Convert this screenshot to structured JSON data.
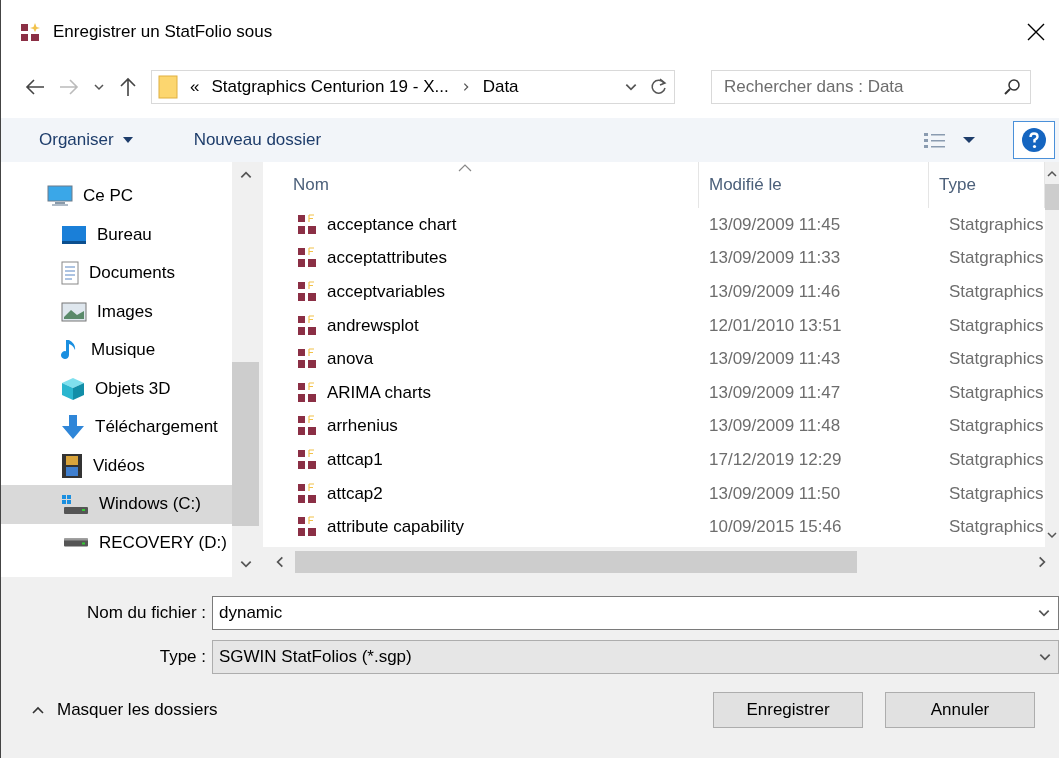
{
  "window": {
    "title": "Enregistrer un StatFolio sous"
  },
  "address_bar": {
    "overflow": "«",
    "segments": [
      "Statgraphics Centurion 19 - X...",
      "Data"
    ]
  },
  "search": {
    "placeholder": "Rechercher dans : Data"
  },
  "toolbar": {
    "organize": "Organiser",
    "new_folder": "Nouveau dossier"
  },
  "sidebar": {
    "items": [
      {
        "label": "Ce PC",
        "kind": "pc",
        "selected": false,
        "children": [
          {
            "label": "Bureau",
            "kind": "desktop",
            "selected": false
          },
          {
            "label": "Documents",
            "kind": "documents",
            "selected": false
          },
          {
            "label": "Images",
            "kind": "images",
            "selected": false
          },
          {
            "label": "Musique",
            "kind": "music",
            "selected": false
          },
          {
            "label": "Objets 3D",
            "kind": "objects3d",
            "selected": false
          },
          {
            "label": "Téléchargement",
            "kind": "downloads",
            "selected": false
          },
          {
            "label": "Vidéos",
            "kind": "videos",
            "selected": false
          },
          {
            "label": "Windows (C:)",
            "kind": "system_drive",
            "selected": true
          },
          {
            "label": "RECOVERY (D:)",
            "kind": "drive",
            "selected": false
          }
        ]
      }
    ]
  },
  "table": {
    "columns": [
      "Nom",
      "Modifié le",
      "Type"
    ],
    "rows": [
      {
        "name": "acceptance chart",
        "modified": "13/09/2009 11:45",
        "type": "Statgraphics",
        "selected": false
      },
      {
        "name": "acceptattributes",
        "modified": "13/09/2009 11:33",
        "type": "Statgraphics",
        "selected": false
      },
      {
        "name": "acceptvariables",
        "modified": "13/09/2009 11:46",
        "type": "Statgraphics",
        "selected": false
      },
      {
        "name": "andrewsplot",
        "modified": "12/01/2010 13:51",
        "type": "Statgraphics",
        "selected": false
      },
      {
        "name": "anova",
        "modified": "13/09/2009 11:43",
        "type": "Statgraphics",
        "selected": false
      },
      {
        "name": "ARIMA charts",
        "modified": "13/09/2009 11:47",
        "type": "Statgraphics",
        "selected": false
      },
      {
        "name": "arrhenius",
        "modified": "13/09/2009 11:48",
        "type": "Statgraphics",
        "selected": false
      },
      {
        "name": "attcap1",
        "modified": "17/12/2019 12:29",
        "type": "Statgraphics",
        "selected": false
      },
      {
        "name": "attcap2",
        "modified": "13/09/2009 11:50",
        "type": "Statgraphics",
        "selected": false
      },
      {
        "name": "attribute capability",
        "modified": "10/09/2015 15:46",
        "type": "Statgraphics",
        "selected": false
      }
    ]
  },
  "filename": {
    "label": "Nom du fichier :",
    "value": "dynamic"
  },
  "filetype": {
    "label": "Type :",
    "value": "SGWIN StatFolios (*.sgp)"
  },
  "hide_folders": "Masquer les dossiers",
  "buttons": [
    "Enregistrer",
    "Annuler"
  ]
}
